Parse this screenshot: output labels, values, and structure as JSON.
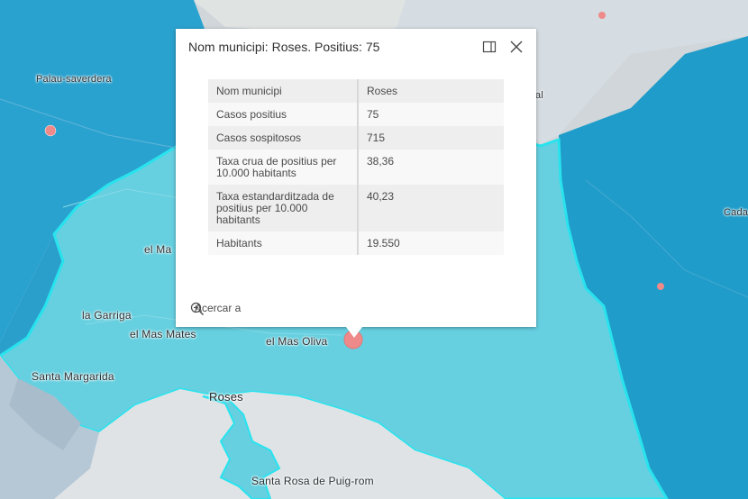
{
  "map": {
    "colors": {
      "land_base": "#d4d9dc",
      "region_dark": "#1f9cc9",
      "region_medium": "#2aa6d0",
      "region_highlight": "#66d0e0",
      "highlight_border": "#28e3ee",
      "sea": "#e0e3e5",
      "case_marker": "#ee8a8a"
    },
    "labels": {
      "palau_saverdera": "Palau-saverdera",
      "el_ma": "el Ma",
      "la_garriga": "la Garriga",
      "el_mas_mates": "el Mas Mates",
      "el_mas_oliva": "el Mas Oliva",
      "santa_margarida": "Santa Margarida",
      "roses": "Roses",
      "santa_rosa": "Santa Rosa de Puig-rom",
      "cada_partial": "Cada",
      "l_partial": "al"
    }
  },
  "popup": {
    "title": "Nom municipi: Roses. Positius: 75",
    "dock_icon": "dock-icon",
    "close_icon": "close-icon",
    "rows": [
      {
        "key": "Nom municipi",
        "value": "Roses"
      },
      {
        "key": "Casos positius",
        "value": "75"
      },
      {
        "key": "Casos sospitosos",
        "value": "715"
      },
      {
        "key": "Taxa crua de positius per 10.000 habitants",
        "value": "38,36"
      },
      {
        "key": "Taxa estandarditzada de positius per 10.000 habitants",
        "value": "40,23"
      },
      {
        "key": "Habitants",
        "value": "19.550"
      }
    ],
    "zoom_label": "Acercar a",
    "zoom_icon": "zoom-in-icon"
  }
}
